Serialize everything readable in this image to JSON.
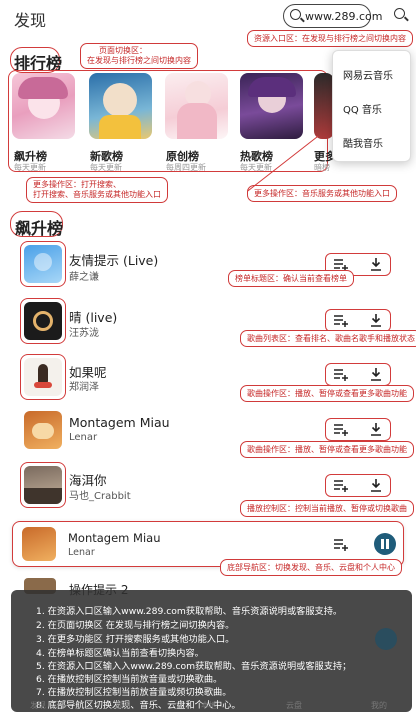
{
  "header": {
    "title": "发现",
    "search_value": "www.289.com"
  },
  "annotations": {
    "resource_entry": "资源入口区：在发现与排行榜之间切换内容",
    "page_switch_1": "页面切换区：",
    "page_switch_2": "在发现与排行榜之间切换内容",
    "more_ops_left_1": "更多操作区：打开搜索、",
    "more_ops_left_2": "打开搜索、音乐服务或其他功能入口",
    "more_ops_right": "更多操作区：音乐服务或其他功能入口",
    "list_title": "榜单标题区：确认当前查看榜单",
    "song_list": "歌曲列表区：查看排名、歌曲名歌手和播放状态",
    "song_ops": "歌曲操作区：播放、暂停或查看更多歌曲功能",
    "song_ops_2": "歌曲操作区：播放、暂停或查看更多歌曲功能",
    "playback": "播放控制区：控制当前播放、暂停或切换歌曲",
    "bottom_nav": "底部导航区：切换发现、音乐、云盘和个人中心"
  },
  "ranking": {
    "section_title": "排行榜",
    "cards": [
      {
        "name": "飙升榜",
        "sub": "每天更新"
      },
      {
        "name": "新歌榜",
        "sub": "每天更新"
      },
      {
        "name": "原创榜",
        "sub": "每周四更新"
      },
      {
        "name": "热歌榜",
        "sub": "每天更新"
      },
      {
        "name": "更多",
        "sub": "暗榜"
      }
    ]
  },
  "dropdown": {
    "items": [
      "网易云音乐",
      "QQ 音乐",
      "酷我音乐"
    ]
  },
  "chart_list": {
    "section_title": "飙升榜",
    "songs": [
      {
        "title": "友情提示 (Live)",
        "artist": "薛之谦"
      },
      {
        "title": "晴 (live)",
        "artist": "汪苏泷"
      },
      {
        "title": "如果呢",
        "artist": "郑润泽"
      },
      {
        "title": "Montagem Miau",
        "artist": "Lenar"
      },
      {
        "title": "海洱你",
        "artist": "马也_Crabbit"
      }
    ]
  },
  "player": {
    "title": "Montagem Miau",
    "artist": "Lenar"
  },
  "behind_overlay": {
    "title": "操作提示 2"
  },
  "overlay": {
    "lines": [
      "1. 在资源入口区输入www.289.com获取帮助、音乐资源说明或客服支持。",
      "2. 在页面切换区   在发现与排行榜之间切换内容。",
      "3. 在更多功能区 打开搜索服务或其他功能入口。",
      "4. 在榜单标题区确认当前查看切换内容。",
      "5. 在资源入口区输入入www.289.com获取帮助、音乐资源说明或客服支持；",
      "6. 在播放控制区控制当前放音量或切换歌曲。",
      "7. 在播放控制区控制当前放音量或频切换歌曲。",
      "8. 底部导航区切换发现、音乐、云盘和个人中心。"
    ]
  },
  "bottom_nav": {
    "items": [
      "发现",
      "歌单",
      "本地",
      "云盘",
      "我的"
    ]
  }
}
